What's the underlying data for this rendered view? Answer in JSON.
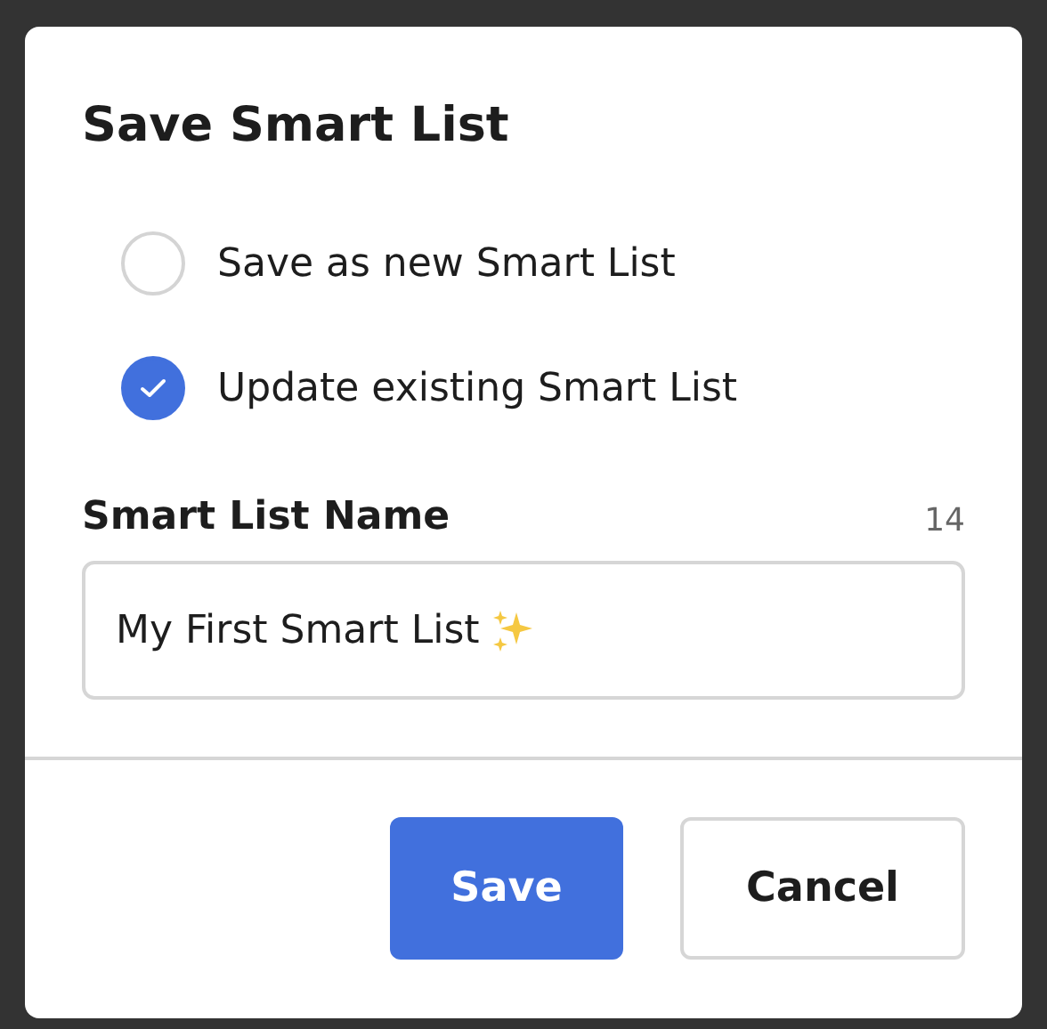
{
  "dialog": {
    "title": "Save Smart List",
    "options": [
      {
        "label": "Save as new Smart List",
        "selected": false
      },
      {
        "label": "Update existing Smart List",
        "selected": true
      }
    ],
    "name_field": {
      "label": "Smart List Name",
      "counter": "14",
      "value": "My First Smart List"
    },
    "buttons": [
      {
        "label": "Save",
        "kind": "primary"
      },
      {
        "label": "Cancel",
        "kind": "secondary"
      }
    ]
  }
}
